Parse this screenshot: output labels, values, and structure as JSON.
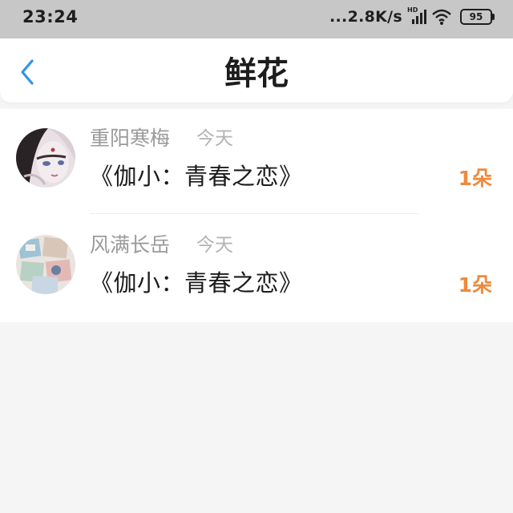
{
  "status_bar": {
    "time": "23:24",
    "network_speed": "...2.8K/s",
    "network_type": "HD",
    "battery_level": "95",
    "icons": [
      "signal-icon",
      "wifi-icon",
      "battery-icon"
    ]
  },
  "header": {
    "back_icon": "chevron-left-icon",
    "title": "鲜花"
  },
  "colors": {
    "accent_blue": "#2f95e6",
    "count_orange": "#ee8a3c",
    "status_bar_bg": "#c7c7c7",
    "page_bg": "#f6f5f5"
  },
  "gifts": [
    {
      "sender": "重阳寒梅",
      "time": "今天",
      "book_title": "《伽小：青春之恋》",
      "count": "1朵",
      "avatar": "avatar-portrait-illustration"
    },
    {
      "sender": "风满长岳",
      "time": "今天",
      "book_title": "《伽小：青春之恋》",
      "count": "1朵",
      "avatar": "avatar-photo-collage"
    }
  ]
}
